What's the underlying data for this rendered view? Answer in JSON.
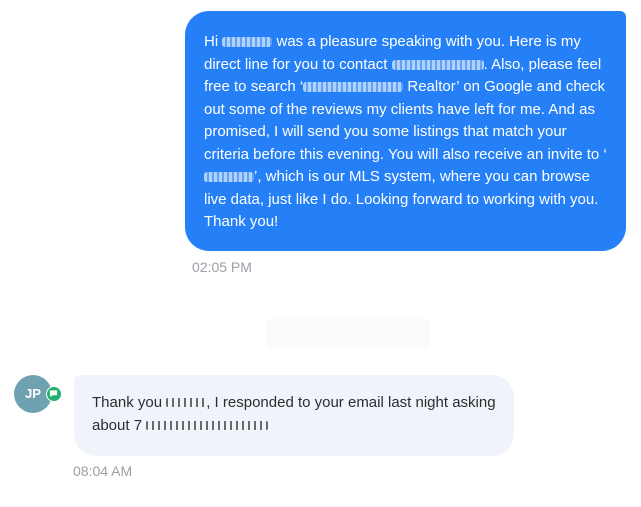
{
  "conversation": {
    "outgoing": {
      "greeting": "Hi",
      "t1": " was a pleasure speaking with you. Here is my direct line for you to contact ",
      "t2": ". Also, please feel free to search ‘",
      "t3": " Realtor’ on Google and check out some of the reviews my clients have left for me. And as promised, I will send you some listings that match your criteria before this evening. You will also receive an invite to ‘",
      "t4": "’, which is our MLS system, where you can browse live data, just like I do. Looking forward to working with you. Thank you!",
      "time": "02:05 PM"
    },
    "incoming": {
      "avatar_initials": "JP",
      "channel_icon": "sms-chat-icon",
      "t1": "Thank you ",
      "t2": ", I responded to your email last night asking about 7",
      "time": "08:04 AM"
    }
  },
  "colors": {
    "outgoing_bubble": "#2580f7",
    "incoming_bubble": "#f0f3f9",
    "avatar": "#6fa2b1",
    "badge": "#23b26d"
  }
}
